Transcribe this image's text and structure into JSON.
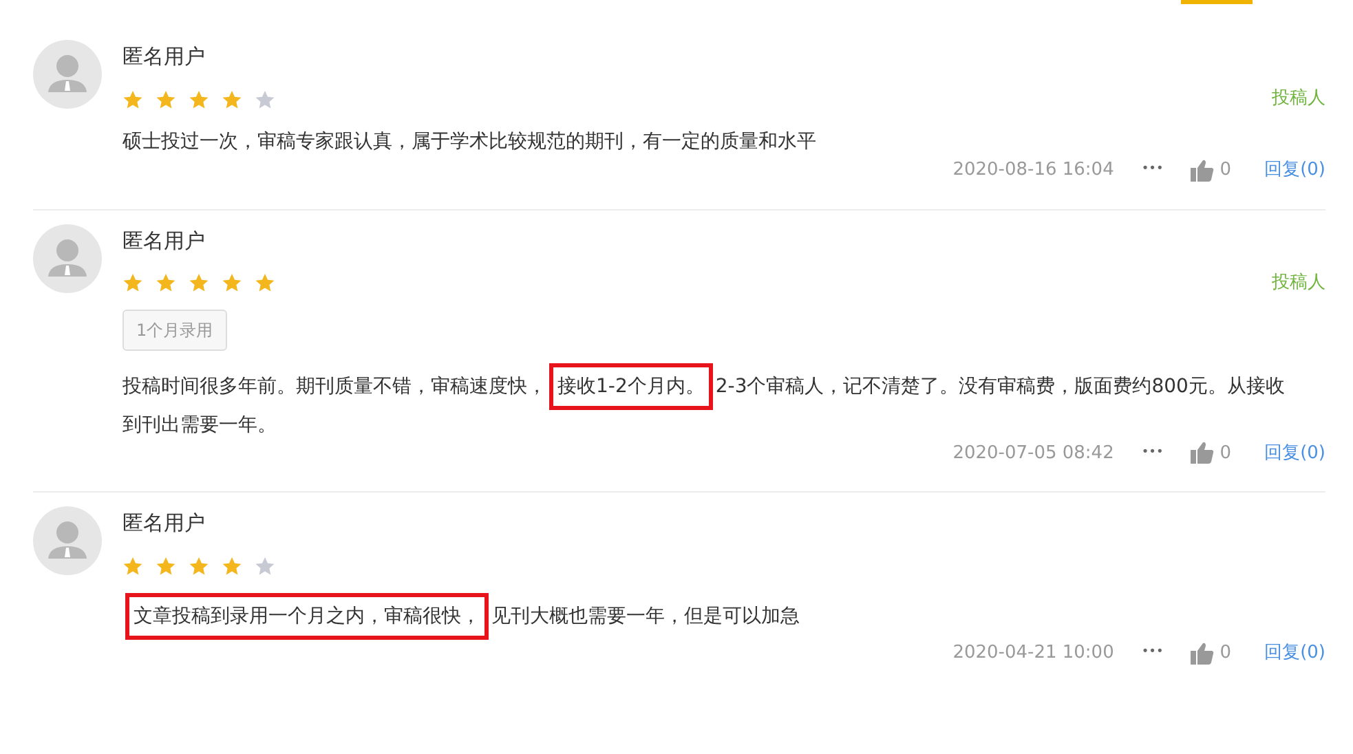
{
  "reviews": [
    {
      "user": "匿名用户",
      "stars": 4,
      "role": "投稿人",
      "text": [
        {
          "t": "硕士投过一次，审稿专家跟认真，属于学术比较规范的期刊，有一定的质量和水平",
          "highlighted": false
        }
      ],
      "date": "2020-08-16 16:04",
      "more": "•••",
      "likes": "0",
      "reply": "回复(0)"
    },
    {
      "user": "匿名用户",
      "stars": 5,
      "role": "投稿人",
      "tag": "1个月录用",
      "text": [
        {
          "t": "投稿时间很多年前。期刊质量不错，审稿速度快，",
          "highlighted": false
        },
        {
          "t": "接收1-2个月内。",
          "highlighted": true
        },
        {
          "t": "2-3个审稿人，记不清楚了。没有审稿费，版面费约800元。从接收到刊出需要一年。",
          "highlighted": false
        }
      ],
      "date": "2020-07-05 08:42",
      "more": "•••",
      "likes": "0",
      "reply": "回复(0)"
    },
    {
      "user": "匿名用户",
      "stars": 4,
      "text": [
        {
          "t": "文章投稿到录用一个月之内，审稿很快，",
          "highlighted": true
        },
        {
          "t": "见刊大概也需要一年，但是可以加急",
          "highlighted": false
        }
      ],
      "date": "2020-04-21 10:00",
      "more": "•••",
      "likes": "0",
      "reply": "回复(0)"
    }
  ]
}
